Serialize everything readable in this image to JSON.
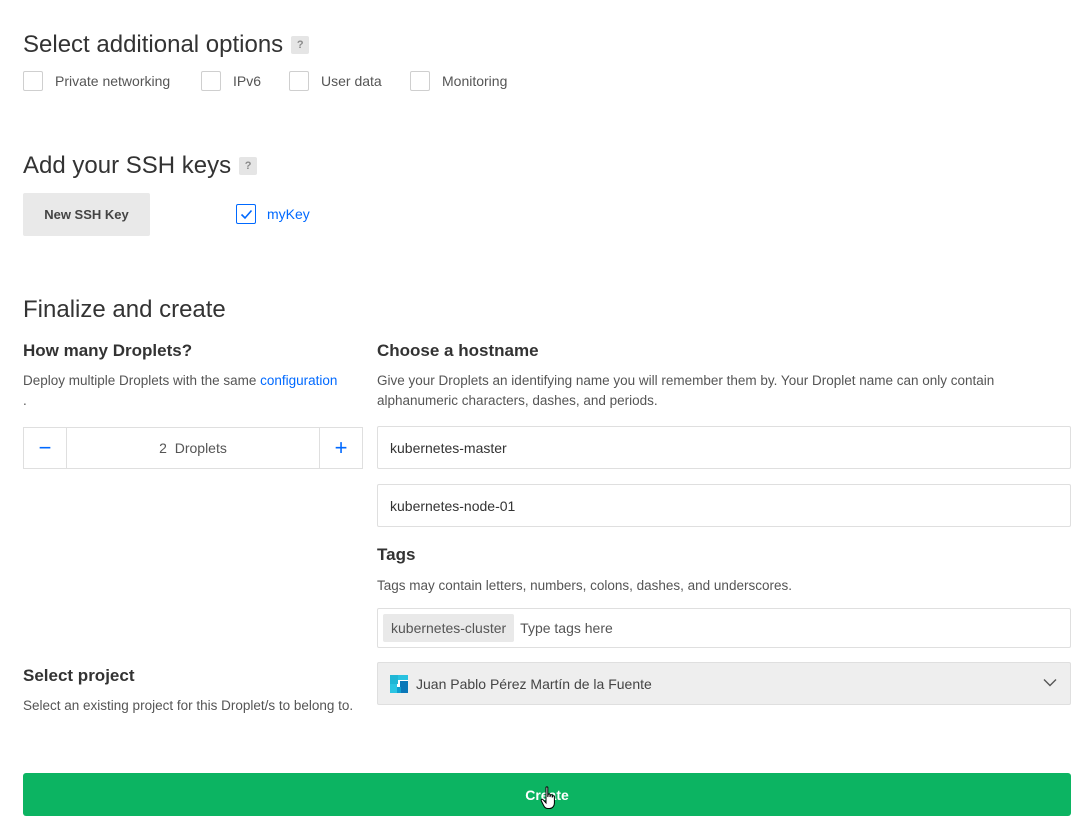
{
  "additional_options": {
    "title": "Select additional options",
    "help": "?",
    "options": [
      {
        "label": "Private networking",
        "checked": false
      },
      {
        "label": "IPv6",
        "checked": false
      },
      {
        "label": "User data",
        "checked": false
      },
      {
        "label": "Monitoring",
        "checked": false
      }
    ]
  },
  "ssh_keys": {
    "title": "Add your SSH keys",
    "help": "?",
    "new_key_label": "New SSH Key",
    "keys": [
      {
        "label": "myKey",
        "checked": true
      }
    ]
  },
  "finalize": {
    "title": "Finalize and create",
    "droplets": {
      "title": "How many Droplets?",
      "desc_prefix": "Deploy multiple Droplets with the same ",
      "desc_link": "configuration",
      "desc_suffix": ".",
      "count": "2",
      "unit": "Droplets",
      "minus": "−",
      "plus": "+"
    },
    "hostname": {
      "title": "Choose a hostname",
      "desc": "Give your Droplets an identifying name you will remember them by. Your Droplet name can only contain alphanumeric characters, dashes, and periods.",
      "values": [
        "kubernetes-master",
        "kubernetes-node-01"
      ]
    },
    "tags": {
      "title": "Tags",
      "desc": "Tags may contain letters, numbers, colons, dashes, and underscores.",
      "chips": [
        "kubernetes-cluster"
      ],
      "placeholder": "Type tags here"
    },
    "project": {
      "title": "Select project",
      "desc": "Select an existing project for this Droplet/s to belong to.",
      "selected": "Juan Pablo Pérez Martín de la Fuente"
    },
    "create_label": "Create"
  },
  "colors": {
    "accent": "#0069ff",
    "create": "#0cb462"
  }
}
